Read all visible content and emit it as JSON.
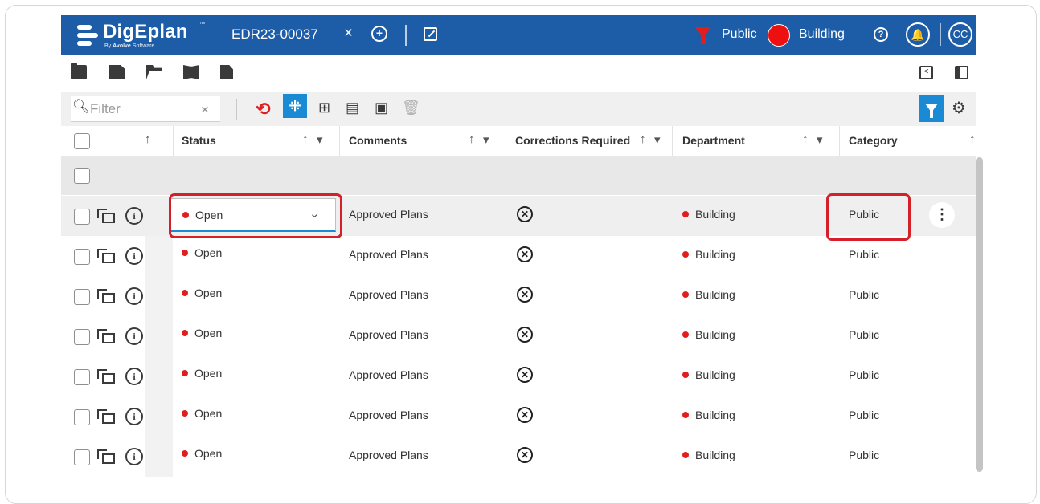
{
  "header": {
    "logo_name": "DigEplan",
    "logo_tm": "™",
    "logo_by_prefix": "By ",
    "logo_by_brand": "Avolve",
    "logo_by_suffix": " Software",
    "record_id": "EDR23-00037",
    "close_glyph": "×",
    "add_glyph": "+",
    "filter_label": "Public",
    "department_label": "Building",
    "help_glyph": "?",
    "bell_glyph": "🔔",
    "avatar_initials": "CC"
  },
  "filter": {
    "placeholder": "Filter",
    "clear_glyph": "×"
  },
  "columns": {
    "status": "Status",
    "comments": "Comments",
    "corrections": "Corrections Required",
    "department": "Department",
    "category": "Category",
    "sort_glyph": "↑",
    "filter_glyph": "▾"
  },
  "rows": [
    {
      "status": "Open",
      "comments": "Approved Plans",
      "department": "Building",
      "category": "Public"
    },
    {
      "status": "Open",
      "comments": "Approved Plans",
      "department": "Building",
      "category": "Public"
    },
    {
      "status": "Open",
      "comments": "Approved Plans",
      "department": "Building",
      "category": "Public"
    },
    {
      "status": "Open",
      "comments": "Approved Plans",
      "department": "Building",
      "category": "Public"
    },
    {
      "status": "Open",
      "comments": "Approved Plans",
      "department": "Building",
      "category": "Public"
    },
    {
      "status": "Open",
      "comments": "Approved Plans",
      "department": "Building",
      "category": "Public"
    },
    {
      "status": "Open",
      "comments": "Approved Plans",
      "department": "Building",
      "category": "Public"
    }
  ],
  "colors": {
    "header_bg": "#1d5ca6",
    "accent_blue": "#1a8ad4",
    "status_red": "#e11d1d",
    "highlight_red": "#d42028"
  }
}
